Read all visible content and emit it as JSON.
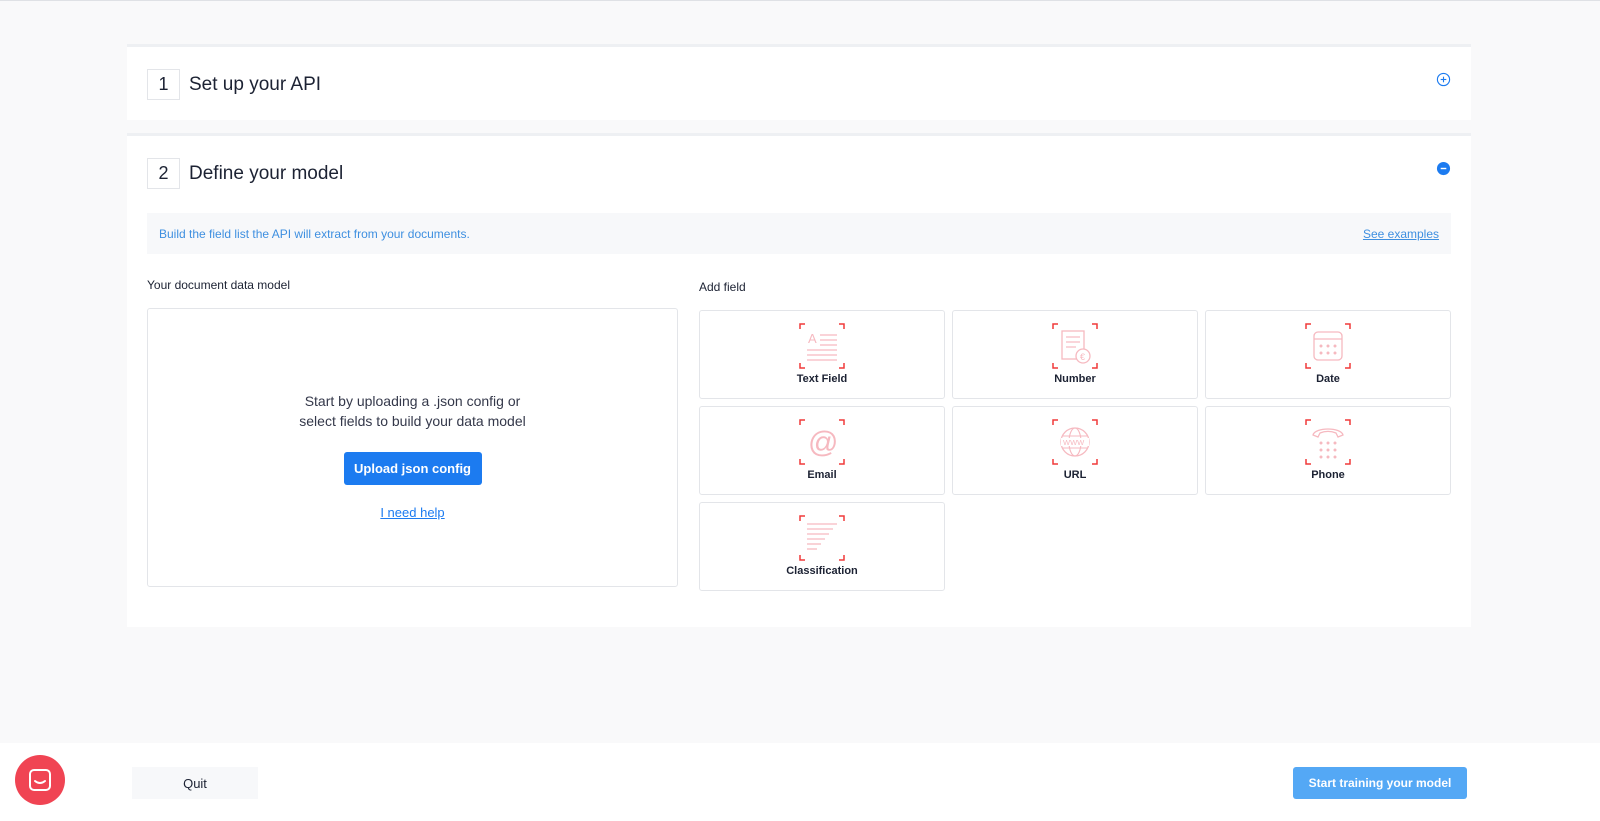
{
  "colors": {
    "primary": "#1c7bf0",
    "primary_disabled": "#54a8f5",
    "link": "#3e8fe0",
    "icon_accent": "#f03a3a",
    "icon_muted": "#f6b9c0",
    "chat": "#f04453"
  },
  "section1": {
    "number": "1",
    "title": "Set up your API",
    "toggle_icon": "plus-circle-icon"
  },
  "section2": {
    "number": "2",
    "title": "Define your model",
    "toggle_icon": "minus-circle-icon",
    "banner": {
      "text": "Build the field list the API will extract from your documents.",
      "link": "See examples"
    },
    "model": {
      "label": "Your document data model",
      "line1": "Start by uploading a .json config or",
      "line2": "select fields to build your data model",
      "upload_button": "Upload json config",
      "help_link": "I need help"
    },
    "add_field": {
      "label": "Add field",
      "fields": [
        {
          "label": "Text Field",
          "icon": "text-field-icon"
        },
        {
          "label": "Number",
          "icon": "number-icon"
        },
        {
          "label": "Date",
          "icon": "calendar-icon"
        },
        {
          "label": "Email",
          "icon": "at-sign-icon"
        },
        {
          "label": "URL",
          "icon": "globe-www-icon"
        },
        {
          "label": "Phone",
          "icon": "phone-icon"
        },
        {
          "label": "Classification",
          "icon": "list-lines-icon"
        }
      ]
    }
  },
  "footer": {
    "quit": "Quit",
    "start": "Start training your model"
  },
  "chat": {
    "icon": "chat-icon"
  }
}
